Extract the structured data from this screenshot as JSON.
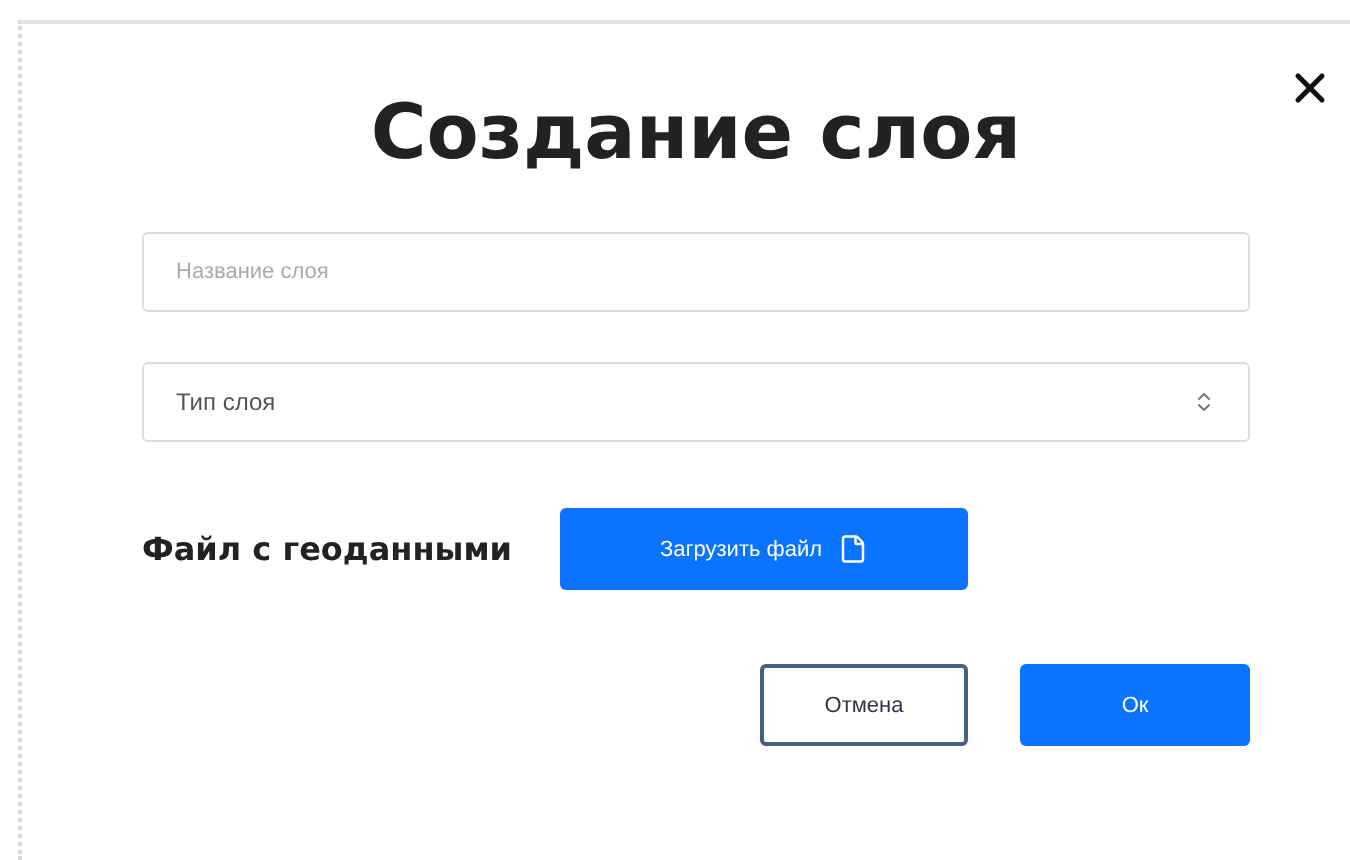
{
  "dialog": {
    "title": "Создание слоя"
  },
  "name_field": {
    "placeholder": "Название слоя"
  },
  "type_select": {
    "value": "Тип слоя"
  },
  "file_row": {
    "label": "Файл с геоданными",
    "button": "Загрузить файл"
  },
  "buttons": [
    {
      "label": "Отмена",
      "kind": "outline"
    },
    {
      "label": "Ок",
      "kind": "primary"
    }
  ]
}
